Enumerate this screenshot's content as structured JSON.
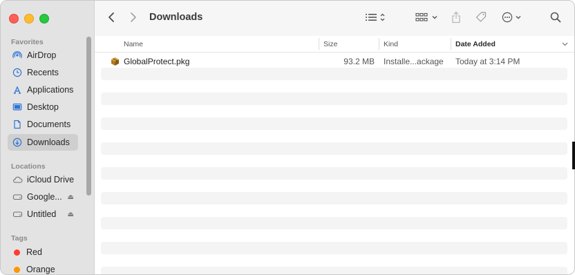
{
  "window": {
    "title": "Downloads"
  },
  "sidebar": {
    "favorites_label": "Favorites",
    "favorites": [
      {
        "label": "AirDrop",
        "icon": "airdrop-icon"
      },
      {
        "label": "Recents",
        "icon": "clock-icon"
      },
      {
        "label": "Applications",
        "icon": "applications-icon"
      },
      {
        "label": "Desktop",
        "icon": "desktop-icon"
      },
      {
        "label": "Documents",
        "icon": "document-icon"
      },
      {
        "label": "Downloads",
        "icon": "download-icon",
        "selected": true
      }
    ],
    "locations_label": "Locations",
    "locations": [
      {
        "label": "iCloud Drive",
        "icon": "cloud-icon"
      },
      {
        "label": "Google...",
        "icon": "drive-icon",
        "eject": true
      },
      {
        "label": "Untitled",
        "icon": "drive-icon",
        "eject": true
      }
    ],
    "tags_label": "Tags",
    "tags": [
      {
        "label": "Red",
        "color": "#ff3b30"
      },
      {
        "label": "Orange",
        "color": "#ff9500"
      }
    ]
  },
  "toolbar": {
    "back_icon": "chevron-left-icon",
    "forward_icon": "chevron-right-icon",
    "view_list_icon": "list-view-icon",
    "group_icon": "grid-view-icon",
    "share_icon": "share-icon",
    "tag_icon": "tag-icon",
    "more_icon": "ellipsis-circle-icon",
    "search_icon": "search-icon"
  },
  "columns": {
    "name": "Name",
    "size": "Size",
    "kind": "Kind",
    "date_added": "Date Added"
  },
  "files": [
    {
      "name": "GlobalProtect.pkg",
      "size": "93.2 MB",
      "kind": "Installe...ackage",
      "date_added": "Today at 3:14 PM"
    }
  ]
}
